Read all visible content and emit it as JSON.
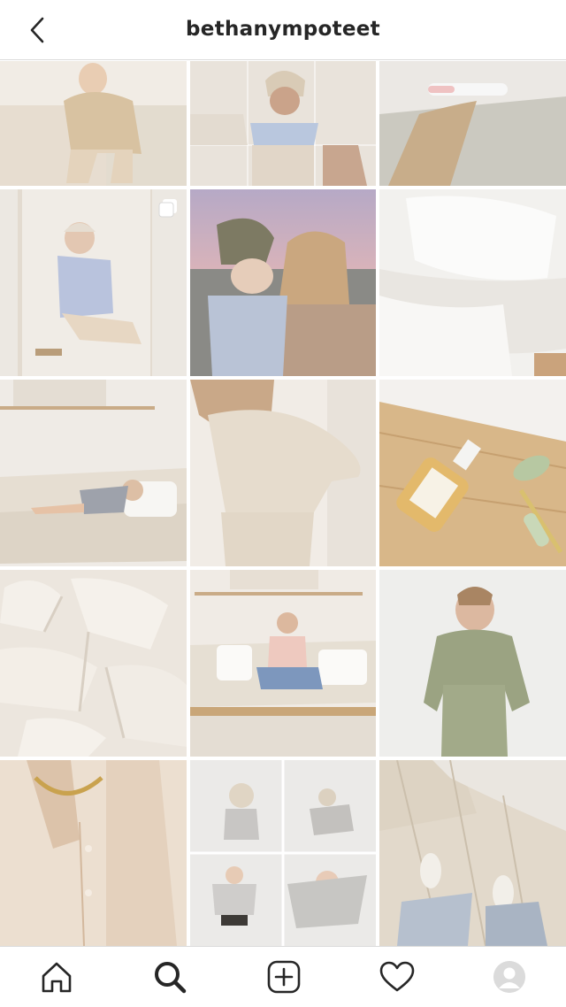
{
  "header": {
    "username": "bethanympoteet",
    "back_icon": "chevron-left-icon"
  },
  "grid": {
    "posts": [
      {
        "id": "post-1",
        "desc": "toddler-cream-sweater",
        "colors": [
          "#eee7dc",
          "#d9c9b0"
        ]
      },
      {
        "id": "post-2",
        "desc": "bucket-hat-collage",
        "colors": [
          "#e8e1d8",
          "#bfb3a6"
        ],
        "multi": false
      },
      {
        "id": "post-3",
        "desc": "pregnancy-test-knit",
        "colors": [
          "#dcd6cd",
          "#b9a690"
        ]
      },
      {
        "id": "post-4",
        "desc": "mirror-selfie-tie-dye",
        "colors": [
          "#eae6df",
          "#c9b9a7"
        ],
        "multi": true
      },
      {
        "id": "post-5",
        "desc": "sunset-selfie-beanie",
        "colors": [
          "#d8b9b8",
          "#7f7a6c"
        ]
      },
      {
        "id": "post-6",
        "desc": "white-bedding",
        "colors": [
          "#f4f3f1",
          "#e4e1dc"
        ]
      },
      {
        "id": "post-7",
        "desc": "child-on-sofa",
        "colors": [
          "#ede8e2",
          "#d4c9bb"
        ]
      },
      {
        "id": "post-8",
        "desc": "cream-knit-set",
        "colors": [
          "#efeae3",
          "#d8cdbf"
        ]
      },
      {
        "id": "post-9",
        "desc": "coconut-oil-jade-roller",
        "colors": [
          "#e7dccb",
          "#c9a879"
        ]
      },
      {
        "id": "post-10",
        "desc": "textured-plaster-art",
        "colors": [
          "#eee9e3",
          "#ddd5cb"
        ]
      },
      {
        "id": "post-11",
        "desc": "woman-on-sofa",
        "colors": [
          "#ebe6df",
          "#cdbfad"
        ]
      },
      {
        "id": "post-12",
        "desc": "sage-lounge-set",
        "colors": [
          "#ebebe8",
          "#9aa183"
        ]
      },
      {
        "id": "post-13",
        "desc": "linen-shirt-gold-chain",
        "colors": [
          "#ead9c8",
          "#c9a98c"
        ]
      },
      {
        "id": "post-14",
        "desc": "toddler-beanie-grid",
        "colors": [
          "#e9e8e6",
          "#bdbab6"
        ]
      },
      {
        "id": "post-15",
        "desc": "wood-floor-sneakers",
        "colors": [
          "#e4dccf",
          "#c9bba5"
        ]
      }
    ]
  },
  "nav": {
    "items": [
      {
        "name": "home",
        "icon": "home-icon"
      },
      {
        "name": "search",
        "icon": "search-icon",
        "active": true
      },
      {
        "name": "new-post",
        "icon": "plus-square-icon"
      },
      {
        "name": "activity",
        "icon": "heart-icon"
      },
      {
        "name": "profile",
        "icon": "avatar-icon"
      }
    ]
  }
}
